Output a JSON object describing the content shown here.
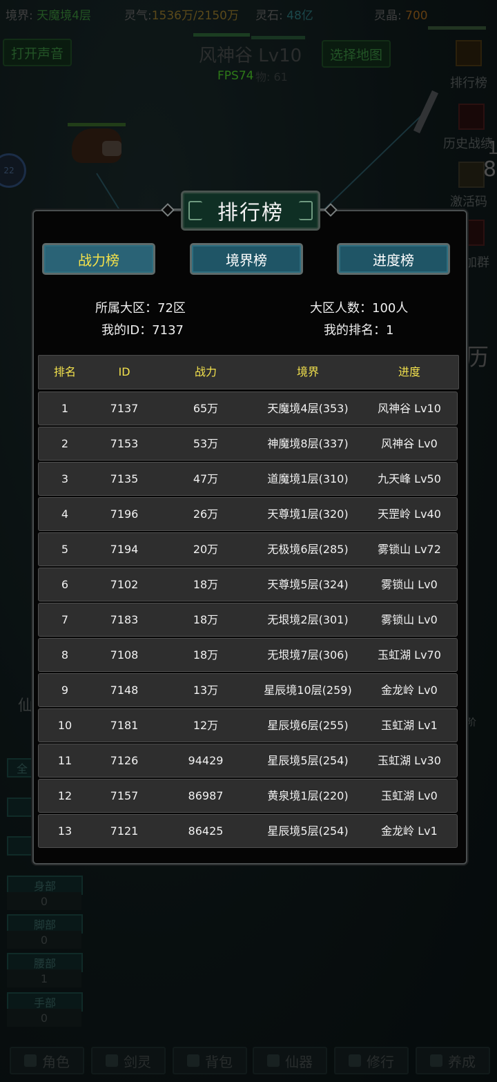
{
  "topbar": {
    "realm_label": "境界:",
    "realm_value": "天魔境4层",
    "qi_label": "灵气:",
    "qi_value": "1536万/2150万",
    "stone_label": "灵石:",
    "stone_value": "48亿",
    "crystal_label": "灵晶:",
    "crystal_value": "700"
  },
  "scene": {
    "sound_button": "打开声音",
    "select_map_button": "选择地图",
    "map_title": "风神谷 Lv10",
    "fps": "FPS74",
    "kill_text": "物: 61",
    "round_badge": "22",
    "side_buttons": [
      "排行榜",
      "历史战绩",
      "激活码",
      "加群"
    ],
    "side_digits": [
      "1",
      "8"
    ],
    "side_glyph": "历",
    "left_panel_glyph": "仙",
    "left_slots": [
      {
        "label": "全",
        "value": ""
      },
      {
        "label": "",
        "value": ""
      },
      {
        "label": "",
        "value": ""
      },
      {
        "label": "身部",
        "value": "0"
      },
      {
        "label": "脚部",
        "value": "0"
      },
      {
        "label": "腰部",
        "value": "1"
      },
      {
        "label": "手部",
        "value": "0"
      }
    ],
    "right_panel_glyph": "阶"
  },
  "bottom_nav": [
    "角色",
    "剑灵",
    "背包",
    "仙器",
    "修行",
    "养成"
  ],
  "modal": {
    "title": "排行榜",
    "tabs": [
      {
        "label": "战力榜",
        "active": true
      },
      {
        "label": "境界榜",
        "active": false
      },
      {
        "label": "进度榜",
        "active": false
      }
    ],
    "info": {
      "region": "所属大区：72区",
      "population": "大区人数：100人",
      "my_id": "我的ID：7137",
      "my_rank": "我的排名：1"
    },
    "columns": [
      "排名",
      "ID",
      "战力",
      "境界",
      "进度"
    ],
    "rows": [
      [
        "1",
        "7137",
        "65万",
        "天魔境4层(353)",
        "风神谷 Lv10"
      ],
      [
        "2",
        "7153",
        "53万",
        "神魔境8层(337)",
        "风神谷 Lv0"
      ],
      [
        "3",
        "7135",
        "47万",
        "道魔境1层(310)",
        "九天峰 Lv50"
      ],
      [
        "4",
        "7196",
        "26万",
        "天尊境1层(320)",
        "天罡岭 Lv40"
      ],
      [
        "5",
        "7194",
        "20万",
        "无极境6层(285)",
        "雾锁山 Lv72"
      ],
      [
        "6",
        "7102",
        "18万",
        "天尊境5层(324)",
        "雾锁山 Lv0"
      ],
      [
        "7",
        "7183",
        "18万",
        "无垠境2层(301)",
        "雾锁山 Lv0"
      ],
      [
        "8",
        "7108",
        "18万",
        "无垠境7层(306)",
        "玉虹湖 Lv70"
      ],
      [
        "9",
        "7148",
        "13万",
        "星辰境10层(259)",
        "金龙岭 Lv0"
      ],
      [
        "10",
        "7181",
        "12万",
        "星辰境6层(255)",
        "玉虹湖 Lv1"
      ],
      [
        "11",
        "7126",
        "94429",
        "星辰境5层(254)",
        "玉虹湖 Lv30"
      ],
      [
        "12",
        "7157",
        "86987",
        "黄泉境1层(220)",
        "玉虹湖 Lv0"
      ],
      [
        "13",
        "7121",
        "86425",
        "星辰境5层(254)",
        "金龙岭 Lv1"
      ]
    ]
  }
}
